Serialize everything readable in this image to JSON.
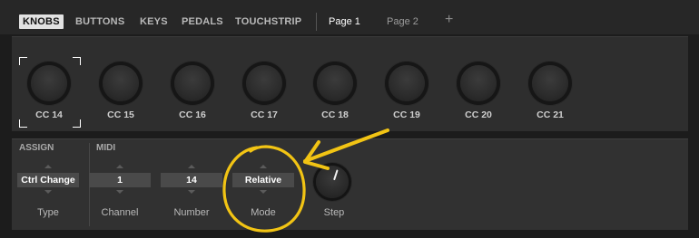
{
  "tabs": {
    "knobs": "KNOBS",
    "buttons": "BUTTONS",
    "keys": "KEYS",
    "pedals": "PEDALS",
    "touchstrip": "TOUCHSTRIP",
    "page1": "Page 1",
    "page2": "Page 2",
    "add": "+"
  },
  "knobs": {
    "selected_index": 0,
    "labels": [
      "CC 14",
      "CC 15",
      "CC 16",
      "CC 17",
      "CC 18",
      "CC 19",
      "CC 20",
      "CC 21"
    ]
  },
  "assign": {
    "assign_label": "ASSIGN",
    "midi_label": "MIDI",
    "type": {
      "value": "Ctrl Change",
      "label": "Type"
    },
    "channel": {
      "value": "1",
      "label": "Channel"
    },
    "number": {
      "value": "14",
      "label": "Number"
    },
    "mode": {
      "value": "Relative",
      "label": "Mode"
    },
    "step": {
      "label": "Step"
    }
  },
  "colors": {
    "background": "#1c1c1c",
    "panel": "#2e2e2e",
    "annotation": "#f2c414"
  },
  "icons": [
    "plus-icon",
    "up-arrow-icon",
    "down-arrow-icon",
    "corner-bracket-icon"
  ]
}
